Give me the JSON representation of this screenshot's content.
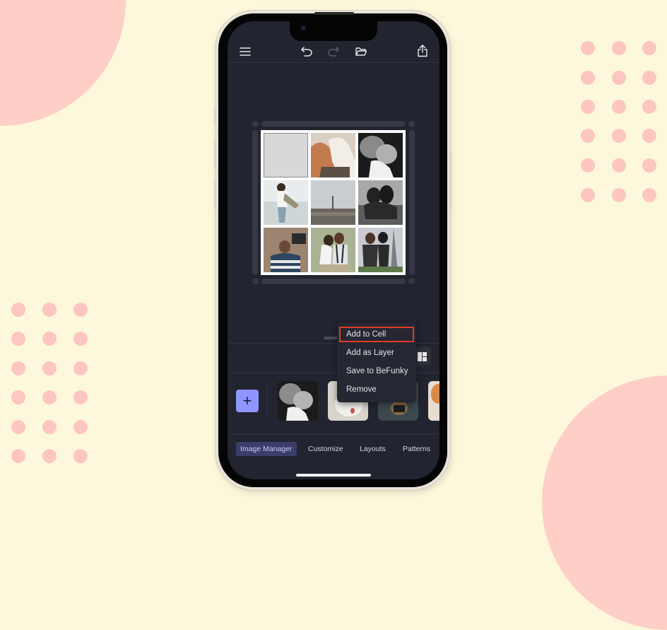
{
  "background": {
    "color": "#fdf8db",
    "accent_color": "#fecfc6",
    "dot_color": "#fdc6c1"
  },
  "topbar": {
    "menu_icon": "hamburger-menu-icon",
    "undo_icon": "undo-icon",
    "redo_icon": "redo-icon",
    "open_icon": "open-folder-icon",
    "share_icon": "share-icon"
  },
  "collage": {
    "grid": "3x3",
    "cells": [
      {
        "content": "empty"
      },
      {
        "content": "couple embrace close-up"
      },
      {
        "content": "father with newborn (b&w)"
      },
      {
        "content": "couple kissing on beach"
      },
      {
        "content": "paris skyline"
      },
      {
        "content": "couple in water (b&w)"
      },
      {
        "content": "man in striped shirt"
      },
      {
        "content": "couple kissing outdoors"
      },
      {
        "content": "couple at eiffel tower"
      }
    ]
  },
  "context_menu": {
    "items": [
      {
        "label": "Add to Cell",
        "highlighted": true
      },
      {
        "label": "Add as Layer",
        "highlighted": false
      },
      {
        "label": "Save to BeFunky",
        "highlighted": false
      },
      {
        "label": "Remove",
        "highlighted": false
      }
    ],
    "highlight_color": "#e33b25"
  },
  "image_manager": {
    "add_button_label": "+",
    "add_button_color": "#8f95ff",
    "thumbnails": [
      {
        "content": "father with newborn (b&w)"
      },
      {
        "content": "white dog"
      },
      {
        "content": "dog with camera"
      },
      {
        "content": "partial image"
      }
    ]
  },
  "tabs": [
    {
      "label": "Image Manager",
      "active": true
    },
    {
      "label": "Customize",
      "active": false
    },
    {
      "label": "Layouts",
      "active": false
    },
    {
      "label": "Patterns",
      "active": false
    }
  ]
}
